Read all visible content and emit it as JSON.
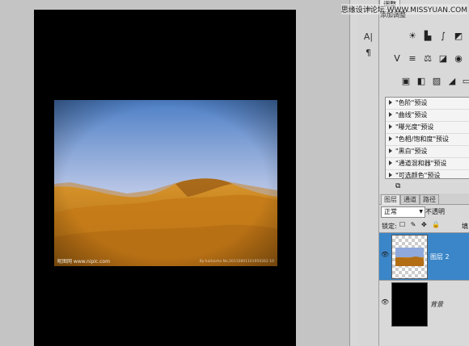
{
  "site_banner": "思缘设计论坛 WWW.MISSYUAN.COM",
  "panel_tab": "调整",
  "adjust_subtitle": "添加调整",
  "watermark_left": "昵图网 www.nipic.com",
  "watermark_right": "By:haitaizhe  No.20110801101950262  10",
  "presets": [
    "\"色阶\"预设",
    "\"曲线\"预设",
    "\"曝光度\"预设",
    "\"色相/饱和度\"预设",
    "\"黑白\"预设",
    "\"通道混和器\"预设",
    "\"可选颜色\"预设"
  ],
  "layer_panel": {
    "tabs": [
      "图层",
      "通道",
      "路径"
    ],
    "blend_mode": "正常",
    "opacity_label": "不透明",
    "lock_label": "锁定:",
    "lock_icons": "☐ ✎ ✥ 🔒",
    "fill_label": "填",
    "layers": [
      {
        "name": "图层 2",
        "selected": true
      },
      {
        "name": "背景",
        "selected": false
      }
    ]
  },
  "tools": {
    "text_tool": "A|",
    "paragraph": "¶"
  },
  "icons": [
    "brightness-icon",
    "levels-icon",
    "curves-icon",
    "exposure-icon",
    "vibrance-icon",
    "hue-sat-icon",
    "color-balance-icon",
    "bw-icon",
    "photo-filter-icon",
    "channel-mixer-icon",
    "invert-icon",
    "posterize-icon",
    "threshold-icon",
    "gradient-map-icon"
  ],
  "colors": {
    "selected_layer": "#3a86c8",
    "canvas_bg": "#c4c4c4",
    "sky_top": "#4d7fc6",
    "sand": "#c9841f"
  }
}
